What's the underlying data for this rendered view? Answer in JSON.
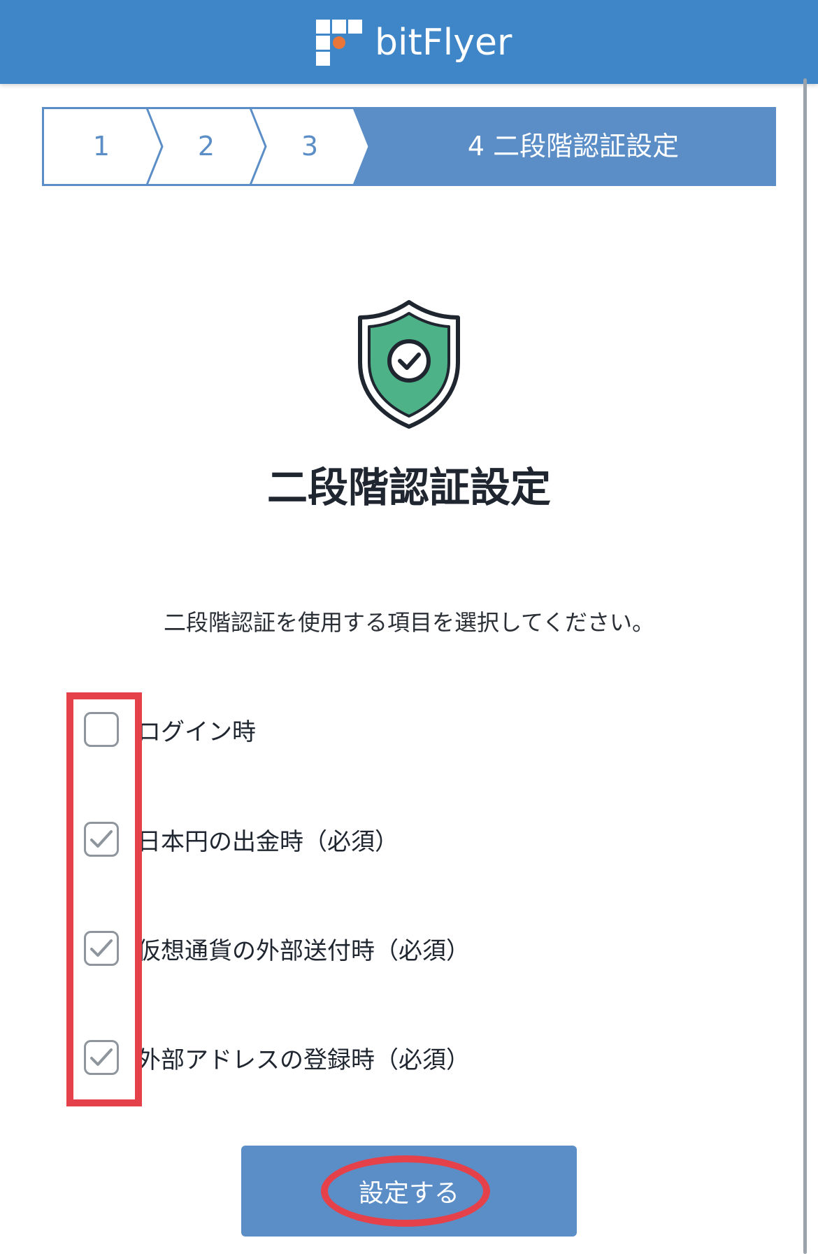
{
  "header": {
    "brand_name": "bitFlyer",
    "background_color": "#3f86c8",
    "logo_icon": "bitflyer-logo-icon",
    "logo_dot_color": "#e8763a"
  },
  "stepper": {
    "steps": [
      {
        "label": "1",
        "state": "completed"
      },
      {
        "label": "2",
        "state": "completed"
      },
      {
        "label": "3",
        "state": "completed"
      },
      {
        "label": "4 二段階認証設定",
        "state": "active"
      }
    ],
    "active_color": "#5b8ec7",
    "inactive_color": "#ffffff",
    "border_color": "#5b8ec7"
  },
  "main": {
    "icon": "shield-check-icon",
    "shield_color": "#4db287",
    "title": "二段階認証設定",
    "instruction": "二段階認証を使用する項目を選択してください。",
    "options": [
      {
        "label": "ログイン時",
        "checked": false
      },
      {
        "label": "日本円の出金時（必須）",
        "checked": true
      },
      {
        "label": "仮想通貨の外部送付時（必須）",
        "checked": true
      },
      {
        "label": "外部アドレスの登録時（必須）",
        "checked": true
      }
    ],
    "submit_label": "設定する",
    "button_color": "#5b8ec7"
  },
  "annotations": {
    "highlight_color": "#e5414b"
  }
}
